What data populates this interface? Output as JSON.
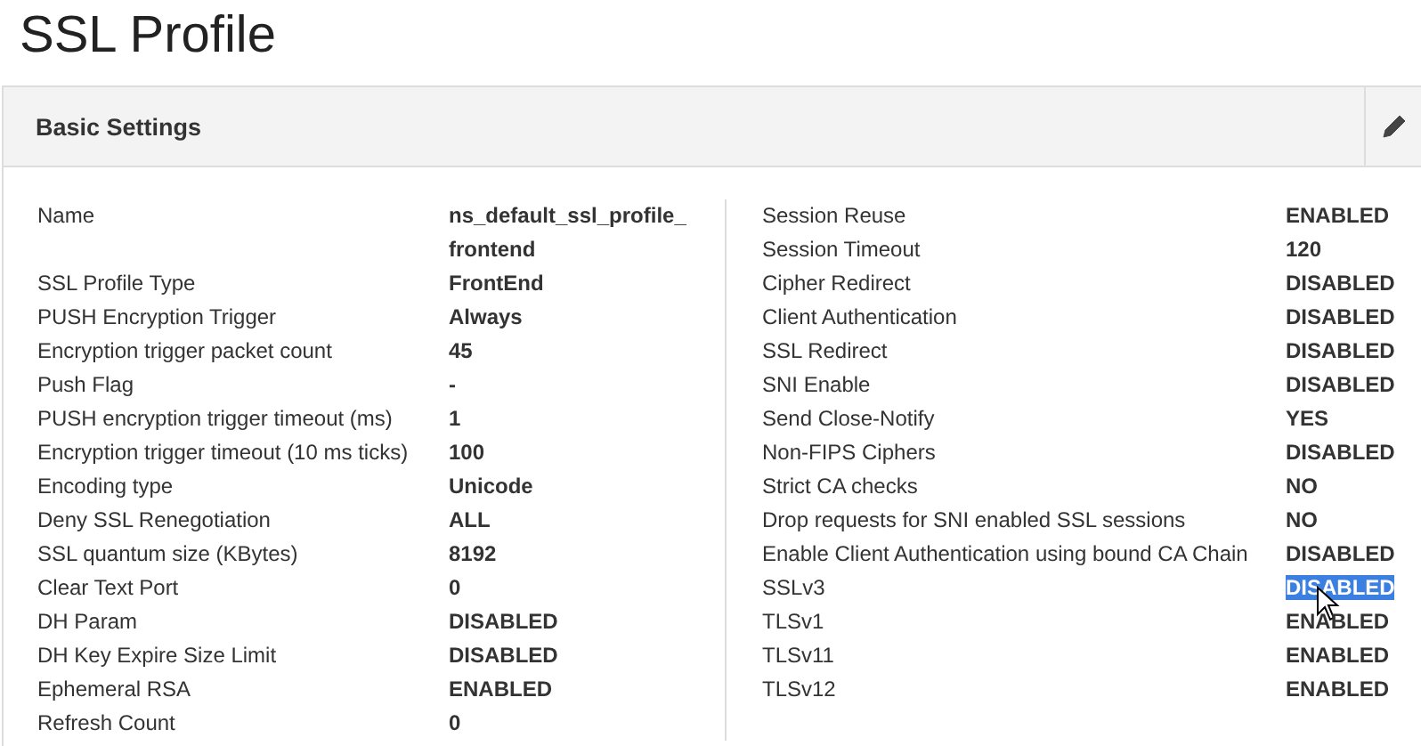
{
  "page": {
    "title": "SSL Profile"
  },
  "panel": {
    "title": "Basic Settings"
  },
  "left": [
    {
      "label": "Name",
      "value": "ns_default_ssl_profile_frontend"
    },
    {
      "label": "SSL Profile Type",
      "value": "FrontEnd"
    },
    {
      "label": "PUSH Encryption Trigger",
      "value": "Always"
    },
    {
      "label": "Encryption trigger packet count",
      "value": "45"
    },
    {
      "label": "Push Flag",
      "value": "-"
    },
    {
      "label": "PUSH encryption trigger timeout (ms)",
      "value": "1"
    },
    {
      "label": "Encryption trigger timeout (10 ms ticks)",
      "value": "100"
    },
    {
      "label": "Encoding type",
      "value": "Unicode"
    },
    {
      "label": "Deny SSL Renegotiation",
      "value": "ALL"
    },
    {
      "label": "SSL quantum size (KBytes)",
      "value": "8192"
    },
    {
      "label": "Clear Text Port",
      "value": "0"
    },
    {
      "label": "DH Param",
      "value": "DISABLED"
    },
    {
      "label": "DH Key Expire Size Limit",
      "value": "DISABLED"
    },
    {
      "label": "Ephemeral RSA",
      "value": "ENABLED"
    },
    {
      "label": "Refresh Count",
      "value": "0"
    }
  ],
  "right": [
    {
      "label": "Session Reuse",
      "value": "ENABLED",
      "text_selected": false
    },
    {
      "label": "Session Timeout",
      "value": "120",
      "text_selected": false
    },
    {
      "label": "Cipher Redirect",
      "value": "DISABLED",
      "text_selected": false
    },
    {
      "label": "Client Authentication",
      "value": "DISABLED",
      "text_selected": false
    },
    {
      "label": "SSL Redirect",
      "value": "DISABLED",
      "text_selected": false
    },
    {
      "label": "SNI Enable",
      "value": "DISABLED",
      "text_selected": false
    },
    {
      "label": "Send Close-Notify",
      "value": "YES",
      "text_selected": false
    },
    {
      "label": "Non-FIPS Ciphers",
      "value": "DISABLED",
      "text_selected": false
    },
    {
      "label": "Strict CA checks",
      "value": "NO",
      "text_selected": false
    },
    {
      "label": "Drop requests for SNI enabled SSL sessions",
      "value": "NO",
      "text_selected": false
    },
    {
      "label": "Enable Client Authentication using bound CA Chain",
      "value": "DISABLED",
      "text_selected": false
    },
    {
      "label": "SSLv3",
      "value": "DISABLED",
      "text_selected": true
    },
    {
      "label": "TLSv1",
      "value": "ENABLED",
      "text_selected": false
    },
    {
      "label": "TLSv11",
      "value": "ENABLED",
      "text_selected": false
    },
    {
      "label": "TLSv12",
      "value": "ENABLED",
      "text_selected": false
    }
  ]
}
